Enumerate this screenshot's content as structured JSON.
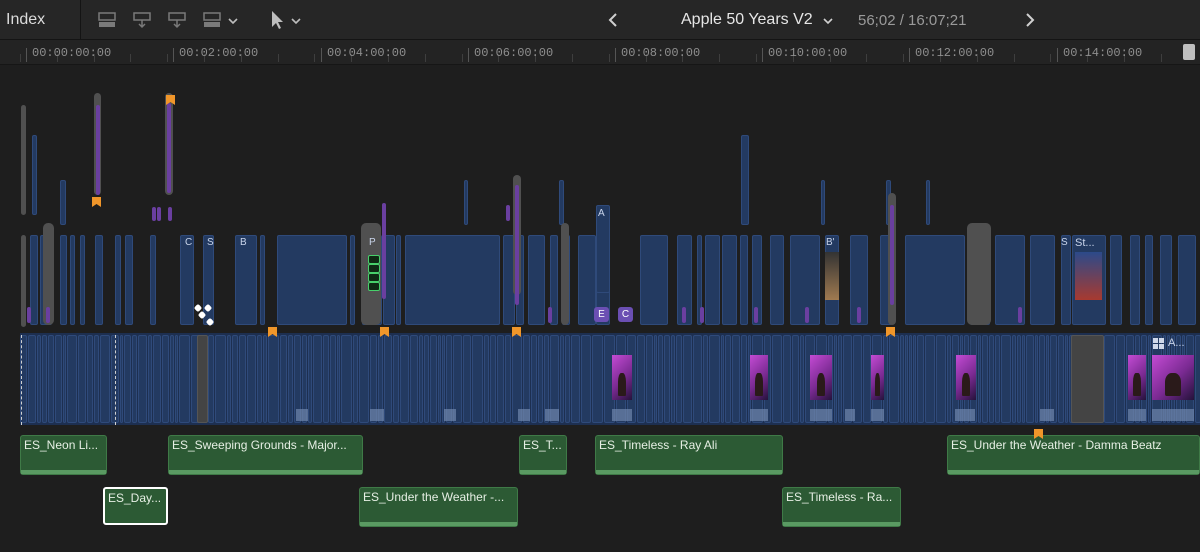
{
  "toolbar": {
    "index_label": "Index",
    "project_title": "Apple 50 Years V2",
    "timecode": "56;02 / 16:07;21",
    "icons": [
      "append-clip-icon",
      "insert-clip-icon",
      "connect-clip-icon",
      "overwrite-clip-icon",
      "select-tool-icon",
      "previous-icon",
      "next-icon"
    ]
  },
  "ruler": {
    "ticks": [
      "00:00:00:00",
      "00:02:00:00",
      "00:04:00:00",
      "00:06:00:00",
      "00:08:00:00",
      "00:10:00:00",
      "00:12:00:00",
      "00:14:00:00"
    ]
  },
  "clip_labels": {
    "c1": "C",
    "c2": "S",
    "c3": "B",
    "c4": "P",
    "c5": "A",
    "c6": "E",
    "c7": "C",
    "c8": "B'",
    "c9": "St...",
    "c10": "S",
    "c11": "A..."
  },
  "audio_clips": [
    {
      "label": "ES_Neon Li..."
    },
    {
      "label": "ES_Sweeping Grounds - Major..."
    },
    {
      "label": "ES_T..."
    },
    {
      "label": "ES_Timeless - Ray Ali"
    },
    {
      "label": "ES_Under the Weather - Damma Beatz"
    },
    {
      "label": "ES_Day..."
    },
    {
      "label": "ES_Under the Weather -..."
    },
    {
      "label": "ES_Timeless - Ra..."
    }
  ],
  "colors": {
    "video_clip": "#233a61",
    "audio_clip": "#2c5a34",
    "marker": "#f0962a",
    "title_clip": "#6a3fa0"
  }
}
